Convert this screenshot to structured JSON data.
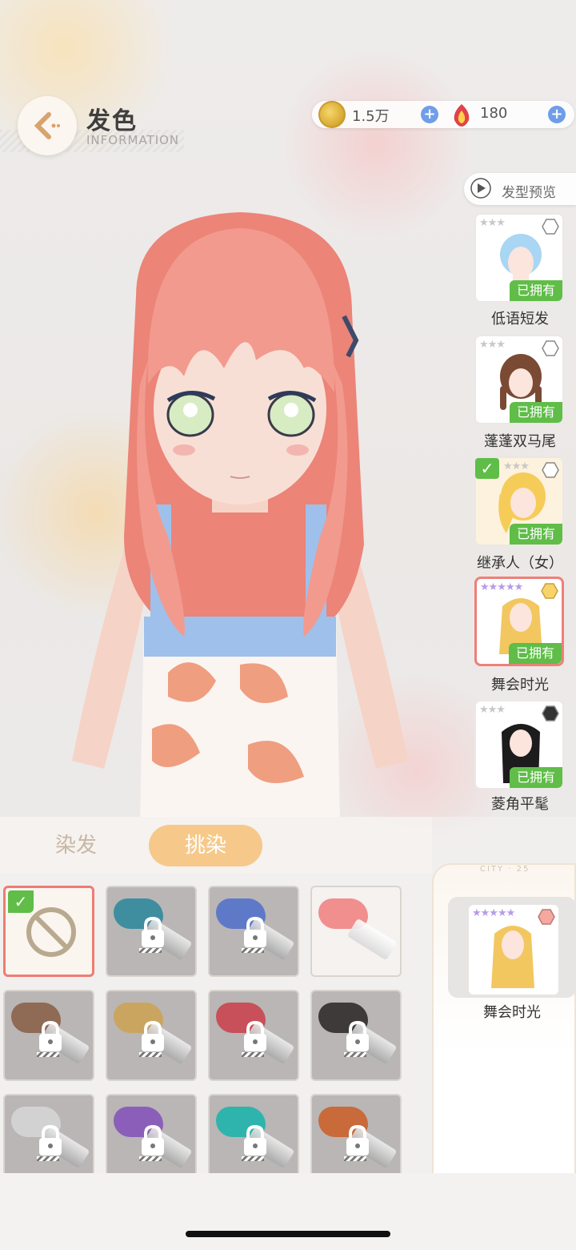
{
  "header": {
    "title": "发色",
    "subtitle": "INFORMATION"
  },
  "currency": {
    "coins": "1.5万",
    "gems": "180"
  },
  "hairstyle_panel": {
    "preview_label": "发型预览",
    "owned_label": "已拥有",
    "items": [
      {
        "name": "低语短发",
        "rarity_stars": "★★★",
        "owned": true,
        "equipped": false,
        "selected": false
      },
      {
        "name": "蓬蓬双马尾",
        "rarity_stars": "★★★",
        "owned": true,
        "equipped": false,
        "selected": false
      },
      {
        "name": "继承人（女）",
        "rarity_stars": "★★★",
        "owned": true,
        "equipped": true,
        "selected": false
      },
      {
        "name": "舞会时光",
        "rarity_stars": "★★★★★",
        "owned": true,
        "equipped": false,
        "selected": true
      },
      {
        "name": "菱角平髦",
        "rarity_stars": "★★★",
        "owned": true,
        "equipped": false,
        "selected": false
      }
    ]
  },
  "tabs": {
    "dye": "染发",
    "highlight": "挑染"
  },
  "color_tiles": [
    {
      "name": "none",
      "color": null,
      "locked": false,
      "selected": true
    },
    {
      "name": "teal",
      "color": "#3f8ea0",
      "locked": true,
      "selected": false
    },
    {
      "name": "blue",
      "color": "#5f79c9",
      "locked": true,
      "selected": false
    },
    {
      "name": "pink",
      "color": "#f18f8f",
      "locked": false,
      "selected": false
    },
    {
      "name": "brown",
      "color": "#8f6a55",
      "locked": true,
      "selected": false
    },
    {
      "name": "gold",
      "color": "#c9a55f",
      "locked": true,
      "selected": false
    },
    {
      "name": "red",
      "color": "#c8505a",
      "locked": true,
      "selected": false
    },
    {
      "name": "black",
      "color": "#3f3a3a",
      "locked": true,
      "selected": false
    },
    {
      "name": "white",
      "color": "#d3d2d2",
      "locked": true,
      "selected": false
    },
    {
      "name": "purple",
      "color": "#8b5fb9",
      "locked": true,
      "selected": false
    },
    {
      "name": "cyan",
      "color": "#2fb3ad",
      "locked": true,
      "selected": false
    },
    {
      "name": "orange",
      "color": "#c96a3b",
      "locked": true,
      "selected": false
    }
  ],
  "preview": {
    "name": "舞会时光",
    "city_label": "CITY · 25"
  },
  "colors": {
    "hair": "#f29a8e",
    "owned_badge": "#5fbd48",
    "selected_border": "#ef7f78",
    "active_tab": "#f6c98a"
  }
}
